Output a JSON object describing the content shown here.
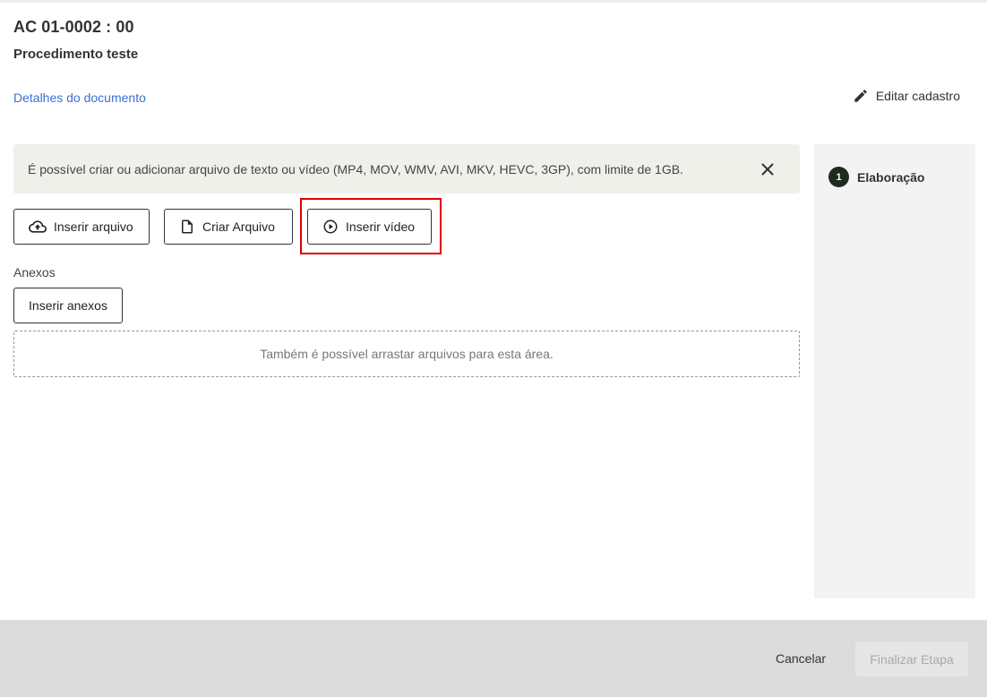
{
  "header": {
    "doc_code": "AC 01-0002 : 00",
    "doc_name": "Procedimento teste",
    "details_link": "Detalhes do documento",
    "edit_label": "Editar cadastro"
  },
  "info_banner": {
    "text": "É possível criar ou adicionar arquivo de texto ou vídeo (MP4, MOV, WMV, AVI, MKV, HEVC, 3GP), com limite de 1GB."
  },
  "actions": {
    "insert_file": "Inserir arquivo",
    "create_file": "Criar Arquivo",
    "insert_video": "Inserir vídeo"
  },
  "attachments": {
    "label": "Anexos",
    "button": "Inserir anexos",
    "dropzone_text": "Também é possível arrastar arquivos para esta área."
  },
  "steps": [
    {
      "number": "1",
      "label": "Elaboração"
    }
  ],
  "footer": {
    "cancel": "Cancelar",
    "finalize": "Finalizar Etapa"
  },
  "colors": {
    "link": "#3b6fd4",
    "highlight": "#e00000",
    "banner_bg": "#f0f0eb",
    "footer_bg": "#dcdcdc",
    "side_panel_bg": "#f3f3f3"
  }
}
